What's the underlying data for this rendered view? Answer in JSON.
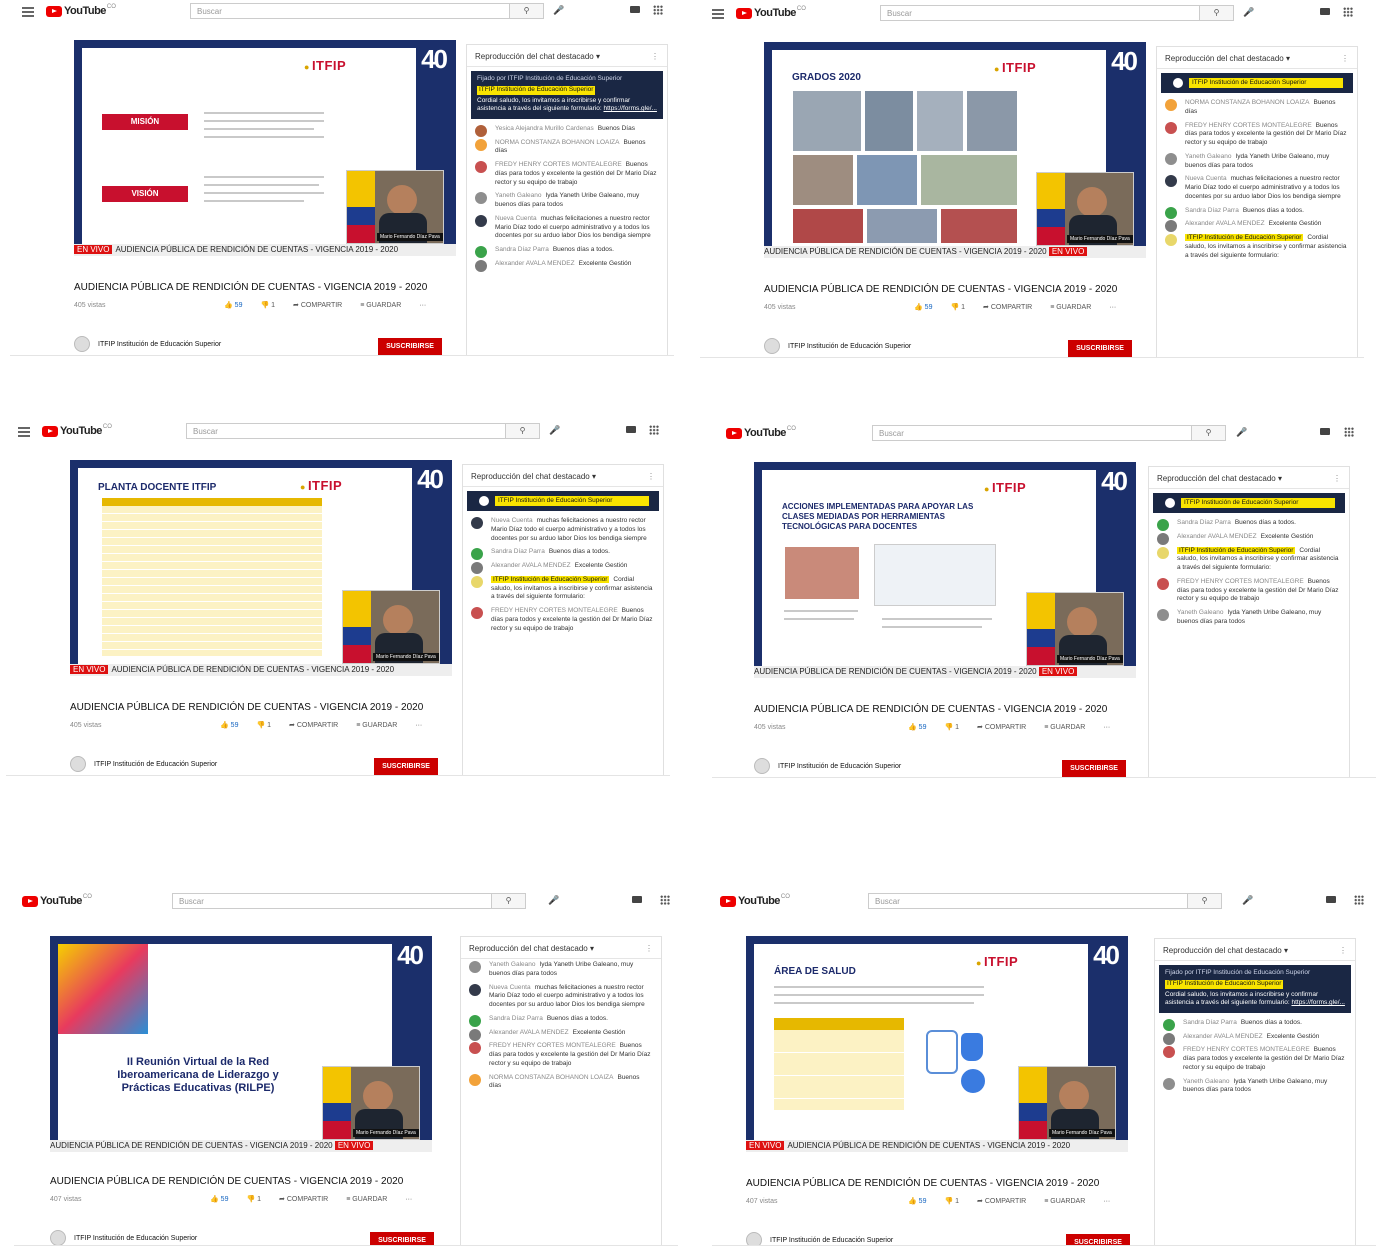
{
  "app": {
    "brand": "YouTube",
    "region": "CO",
    "search_placeholder": "Buscar"
  },
  "video": {
    "title": "AUDIENCIA PÚBLICA DE RENDICIÓN DE CUENTAS - VIGENCIA 2019 - 2020",
    "ticker_live": "EN VIVO",
    "ticker_text": "AUDIENCIA PÚBLICA DE RENDICIÓN DE CUENTAS - VIGENCIA 2019 - 2020",
    "logo_text": "ITFIP",
    "anniversary": "40",
    "presenter": "Mario Fernando Díaz Pava",
    "actions": {
      "likes": "59",
      "dislikes": "1",
      "share": "COMPARTIR",
      "save": "GUARDAR",
      "more": "···"
    }
  },
  "channel": {
    "name": "ITFIP Institución de Educación Superior",
    "subscribe": "SUSCRIBIRSE"
  },
  "chat": {
    "header": "Reproducción del chat destacado",
    "pinned_by": "Fijado por ITFIP Institución de Educación Superior",
    "pinned_author": "ITFIP Institución de Educación Superior",
    "pinned_text": "Cordial saludo, los invitamos a inscribirse y confirmar asistencia a través del siguiente formulario:",
    "pinned_link": "https://forms.gle/...",
    "messages": [
      {
        "author": "Yesica Alejandra Murillo Cardenas",
        "text": "Buenos Días"
      },
      {
        "author": "NORMA CONSTANZA BOHANON LOAIZA",
        "text": "Buenos días"
      },
      {
        "author": "FREDY HENRY CORTES MONTEALEGRE",
        "text": "Buenos días para todos y excelente la gestión del Dr Mario Díaz rector y su equipo de trabajo"
      },
      {
        "author": "Yaneth Galeano",
        "text": "Iyda Yaneth Uribe Galeano, muy buenos días para todos"
      },
      {
        "author": "Nueva Cuenta",
        "text": "muchas felicitaciones a nuestro rector Mario Díaz todo el cuerpo administrativo y a todos los docentes por su arduo labor Dios los bendiga siempre"
      },
      {
        "author": "Sandra Díaz Parra",
        "text": "Buenos días a todos."
      },
      {
        "author": "Alexander AVALA MENDEZ",
        "text": "Excelente Gestión"
      }
    ]
  },
  "screens": [
    {
      "slide_title": "MISIÓN / VISIÓN",
      "labels": [
        "MISIÓN",
        "VISIÓN"
      ],
      "views": "405 vistas"
    },
    {
      "slide_title": "GRADOS 2020",
      "views": "405 vistas"
    },
    {
      "slide_title": "PLANTA DOCENTE ITFIP",
      "views": "405 vistas"
    },
    {
      "slide_title": "ACCIONES IMPLEMENTADAS PARA APOYAR LAS CLASES MEDIADAS POR HERRAMIENTAS TECNOLÓGICAS PARA DOCENTES",
      "views": "405 vistas"
    },
    {
      "slide_title": "II Reunión Virtual de la Red Iberoamericana de Liderazgo y Prácticas Educativas (RILPE)",
      "views": "407 vistas"
    },
    {
      "slide_title": "ÁREA DE SALUD",
      "views": "407 vistas"
    }
  ]
}
